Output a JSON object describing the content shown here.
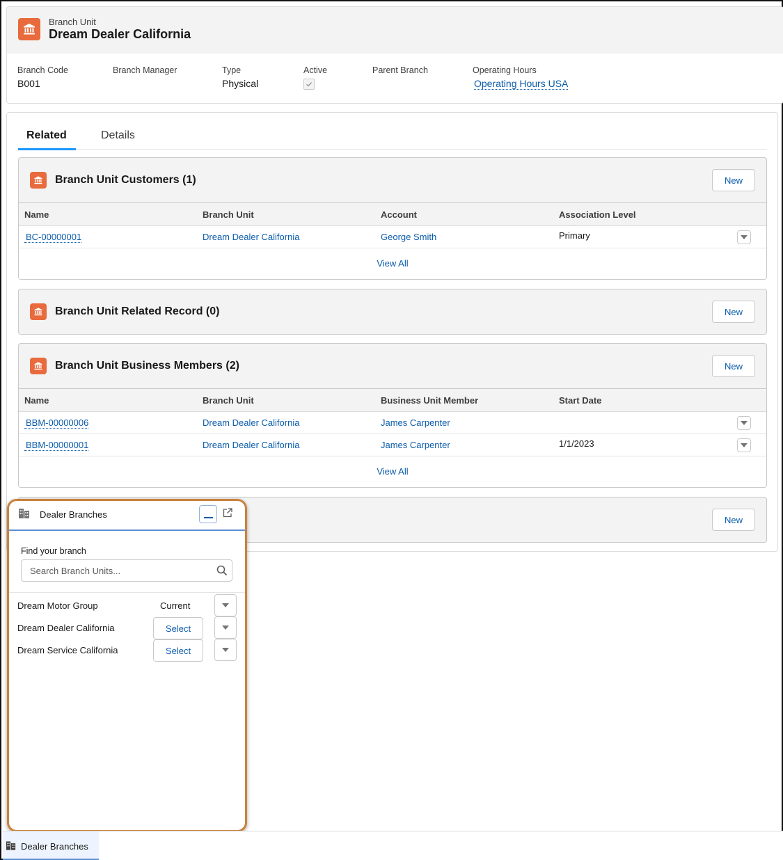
{
  "record": {
    "object_type": "Branch Unit",
    "title": "Dream Dealer California",
    "icon": "bank-icon",
    "brand_color": "#e86a3d",
    "fields": [
      {
        "label": "Branch Code",
        "value": "B001"
      },
      {
        "label": "Branch Manager",
        "value": ""
      },
      {
        "label": "Type",
        "value": "Physical"
      },
      {
        "label": "Active",
        "value": "checked"
      },
      {
        "label": "Parent Branch",
        "value": ""
      },
      {
        "label": "Operating Hours",
        "value": "Operating Hours USA"
      }
    ]
  },
  "tabs": [
    {
      "label": "Related",
      "active": true
    },
    {
      "label": "Details",
      "active": false
    }
  ],
  "related_lists": [
    {
      "title": "Branch Unit Customers (1)",
      "new_label": "New",
      "columns": [
        "Name",
        "Branch Unit",
        "Account",
        "Association Level"
      ],
      "rows": [
        [
          "BC-00000001",
          "Dream Dealer California",
          "George Smith",
          "Primary"
        ]
      ],
      "view_all": "View All"
    },
    {
      "title": "Branch Unit Related Record (0)",
      "new_label": "New"
    },
    {
      "title": "Branch Unit Business Members (2)",
      "new_label": "New",
      "columns": [
        "Name",
        "Branch Unit",
        "Business Unit Member",
        "Start Date"
      ],
      "rows": [
        [
          "BBM-00000006",
          "Dream Dealer California",
          "James Carpenter",
          ""
        ],
        [
          "BBM-00000001",
          "Dream Dealer California",
          "James Carpenter",
          "1/1/2023"
        ]
      ],
      "view_all": "View All"
    },
    {
      "title": "",
      "new_label": "New"
    }
  ],
  "utility_panel": {
    "title": "Dealer Branches",
    "icon": "building-icon",
    "find_label": "Find your branch",
    "search_placeholder": "Search Branch Units...",
    "search_value": "",
    "branches": [
      {
        "name": "Dream Motor Group",
        "status": "Current",
        "action": ""
      },
      {
        "name": "Dream Dealer California",
        "status": "",
        "action": "Select"
      },
      {
        "name": "Dream Service California",
        "status": "",
        "action": "Select"
      }
    ],
    "highlight_color": "#c9823d"
  },
  "utility_bar": {
    "items": [
      {
        "label": "Dealer Branches",
        "icon": "building-icon"
      }
    ]
  },
  "colors": {
    "link": "#0b5cab",
    "tab_active": "#1b96ff"
  }
}
